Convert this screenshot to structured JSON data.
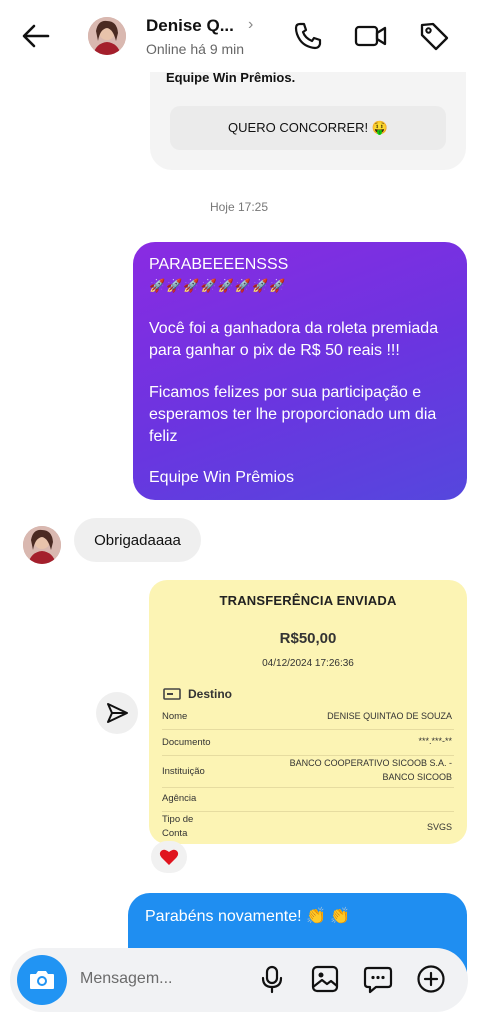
{
  "header": {
    "name": "Denise Q...",
    "status": "Online há 9 min",
    "chevron": "›"
  },
  "previous_message": {
    "signature": "Equipe Win Prêmios.",
    "cta_label": "QUERO CONCORRER! 🤑"
  },
  "timestamp": "Hoje 17:25",
  "sent_message": {
    "lines": [
      "PARABEEEENSSS",
      "🚀🚀🚀🚀🚀🚀🚀🚀",
      "Você foi a ganhadora da roleta premiada",
      "para ganhar o pix de R$ 50 reais !!!",
      "Ficamos felizes por sua participação e",
      "esperamos ter lhe proporcionado um dia",
      "feliz",
      "Equipe Win Prêmios"
    ]
  },
  "received_message": {
    "text": "Obrigadaaaa"
  },
  "receipt": {
    "title": "TRANSFERÊNCIA ENVIADA",
    "amount": "R$50,00",
    "datetime": "04/12/2024 17:26:36",
    "section": "Destino",
    "rows": [
      {
        "label": "Nome",
        "value": "DENISE QUINTAO DE SOUZA"
      },
      {
        "label": "Documento",
        "value": "***.***-**"
      },
      {
        "label": "Instituição",
        "value": "BANCO COOPERATIVO SICOOB S.A. -",
        "value2": "BANCO SICOOB"
      },
      {
        "label": "Agência",
        "value": ""
      },
      {
        "label": "Tipo de",
        "label2": "Conta",
        "value": "SVGS"
      }
    ],
    "reaction": "❤️"
  },
  "last_message": {
    "text": "Parabéns novamente! 👏 👏"
  },
  "composer": {
    "placeholder": "Mensagem..."
  },
  "colors": {
    "accent_blue": "#1f8ef1",
    "purple_start": "#8a2be2",
    "purple_end": "#5547dd",
    "receipt_bg": "#fcf4b4"
  }
}
